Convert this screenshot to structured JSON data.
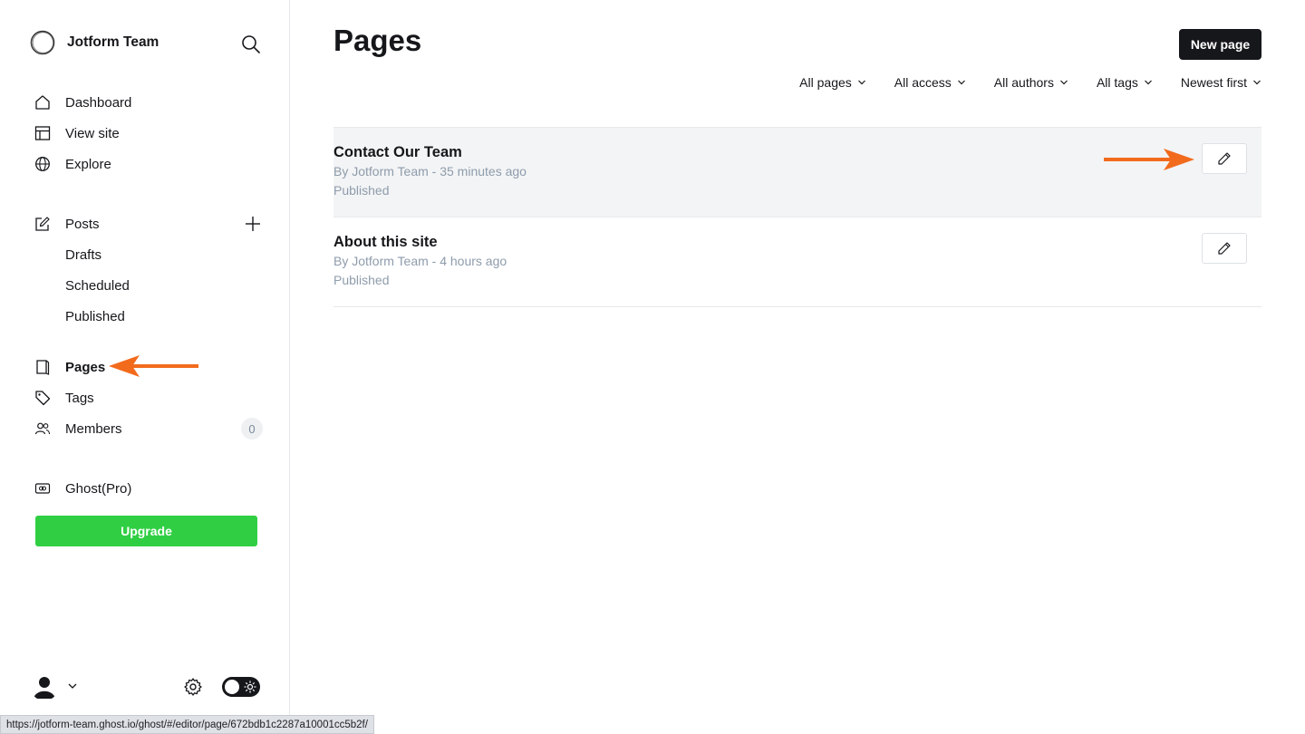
{
  "sidebar": {
    "brand": "Jotform Team",
    "nav_main": [
      {
        "label": "Dashboard",
        "icon": "house-icon"
      },
      {
        "label": "View site",
        "icon": "layout-icon"
      },
      {
        "label": "Explore",
        "icon": "globe-icon"
      }
    ],
    "posts": {
      "label": "Posts",
      "sub": [
        "Drafts",
        "Scheduled",
        "Published"
      ]
    },
    "pages": "Pages",
    "tags": "Tags",
    "members": "Members",
    "members_count": "0",
    "ghost_pro": "Ghost(Pro)",
    "upgrade": "Upgrade"
  },
  "main": {
    "title": "Pages",
    "new_page": "New page",
    "filters": [
      "All pages",
      "All access",
      "All authors",
      "All tags",
      "Newest first"
    ],
    "rows": [
      {
        "title": "Contact Our Team",
        "meta": "By Jotform Team - 35 minutes ago",
        "status": "Published"
      },
      {
        "title": "About this site",
        "meta": "By Jotform Team - 4 hours ago",
        "status": "Published"
      }
    ]
  },
  "status_url": "https://jotform-team.ghost.io/ghost/#/editor/page/672bdb1c2287a10001cc5b2f/",
  "colors": {
    "accent_arrow": "#f26b1d",
    "upgrade_green": "#30cf43",
    "dark": "#15171a"
  }
}
